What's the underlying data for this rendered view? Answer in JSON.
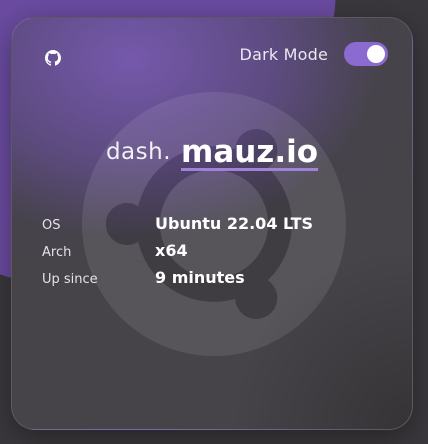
{
  "header": {
    "github_icon": "github-icon",
    "dark_mode_label": "Dark Mode",
    "dark_mode_on": true
  },
  "brand": {
    "prefix": "dash.",
    "site": "mauz.io"
  },
  "info": [
    {
      "key": "OS",
      "value": "Ubuntu 22.04 LTS"
    },
    {
      "key": "Arch",
      "value": "x64"
    },
    {
      "key": "Up since",
      "value": "9 minutes"
    }
  ],
  "colors": {
    "accent": "#8c6bd0",
    "card": "#464448",
    "background_purple": "#6a4ba0"
  },
  "background_logo": "ubuntu-logo-icon"
}
